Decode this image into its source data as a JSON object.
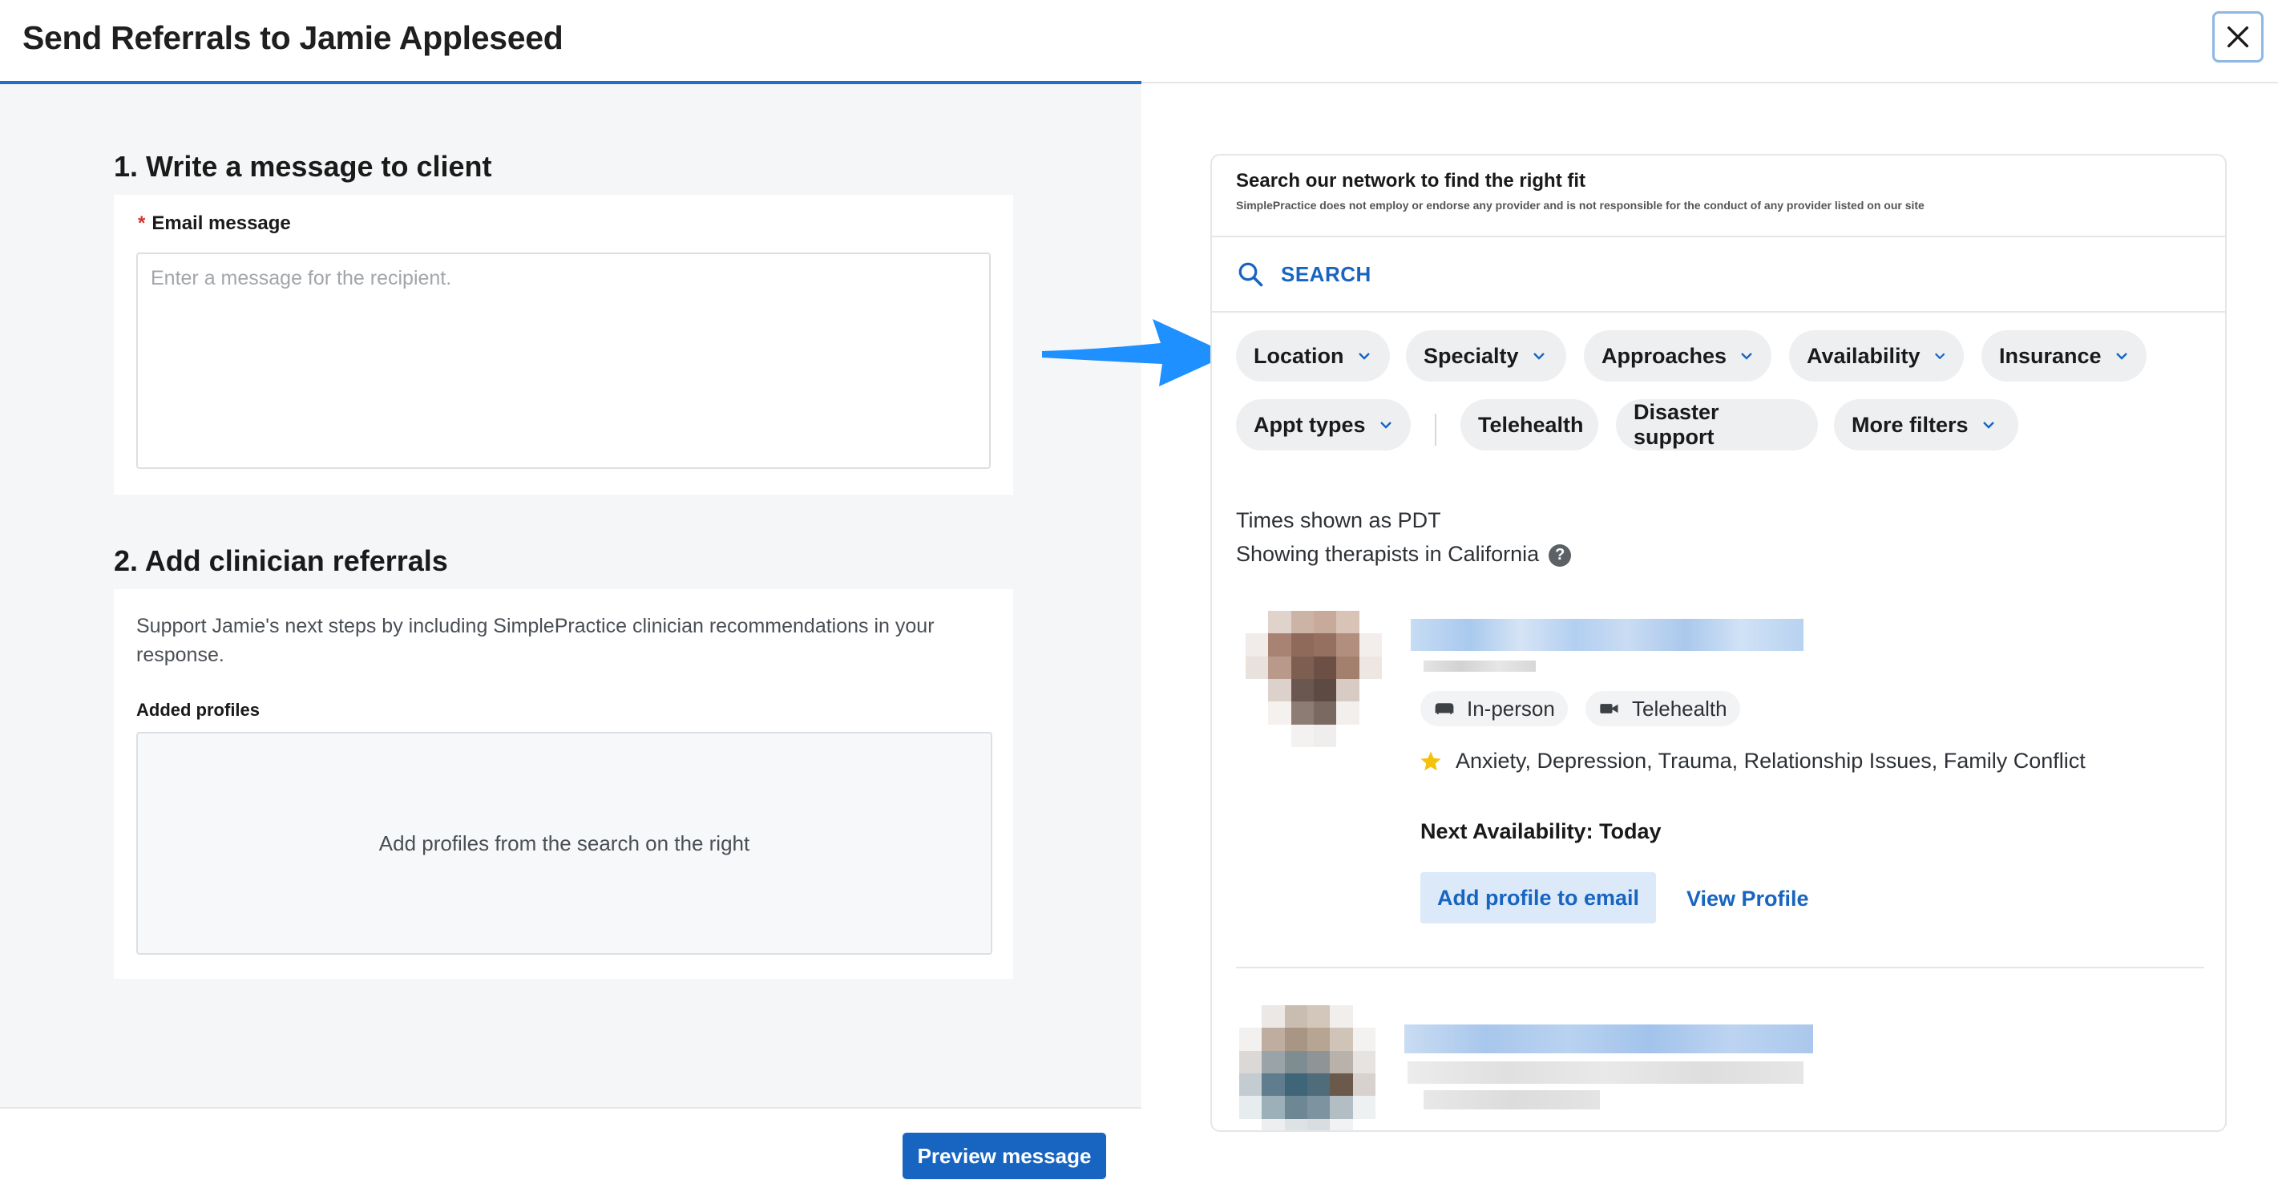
{
  "header": {
    "title": "Send Referrals to Jamie Appleseed",
    "close_icon": "close-icon"
  },
  "message_section": {
    "title": "1. Write a message to client",
    "required_marker": "*",
    "email_label": "Email message",
    "email_placeholder": "Enter a message for the recipient.",
    "email_value": ""
  },
  "referral_section": {
    "title": "2. Add clinician referrals",
    "description": "Support Jamie's next steps by including SimplePractice clinician recommendations in your response.",
    "added_profiles_label": "Added profiles",
    "empty_state": "Add profiles from the search on the right"
  },
  "footer": {
    "preview_label": "Preview message"
  },
  "search_panel": {
    "title": "Search our network to find the right fit",
    "disclaimer": "SimplePractice does not employ or endorse any provider and is not responsible for the conduct of any provider listed on our site",
    "search_label": "SEARCH",
    "filters": [
      {
        "label": "Location",
        "has_dropdown": true
      },
      {
        "label": "Specialty",
        "has_dropdown": true
      },
      {
        "label": "Approaches",
        "has_dropdown": true
      },
      {
        "label": "Availability",
        "has_dropdown": true
      },
      {
        "label": "Insurance",
        "has_dropdown": true
      },
      {
        "label": "Appt types",
        "has_dropdown": true
      },
      {
        "label": "Telehealth",
        "has_dropdown": false
      },
      {
        "label": "Disaster support",
        "has_dropdown": false
      },
      {
        "label": "More filters",
        "has_dropdown": true
      }
    ],
    "timezone_note": "Times shown as PDT",
    "location_note": "Showing therapists in California",
    "help_glyph": "?"
  },
  "profiles": [
    {
      "name_redacted": true,
      "tags": [
        {
          "label": "In-person",
          "icon": "couch-icon"
        },
        {
          "label": "Telehealth",
          "icon": "video-camera-icon"
        }
      ],
      "specialties": "Anxiety, Depression, Trauma, Relationship Issues, Family Conflict",
      "specialty_icon": "star-icon",
      "next_availability": "Next Availability: Today",
      "add_label": "Add profile to email",
      "view_label": "View Profile"
    },
    {
      "name_redacted": true
    }
  ],
  "colors": {
    "primary": "#1765c1",
    "arrow": "#1e90ff",
    "star": "#f4c20d",
    "required": "#d2302c"
  }
}
